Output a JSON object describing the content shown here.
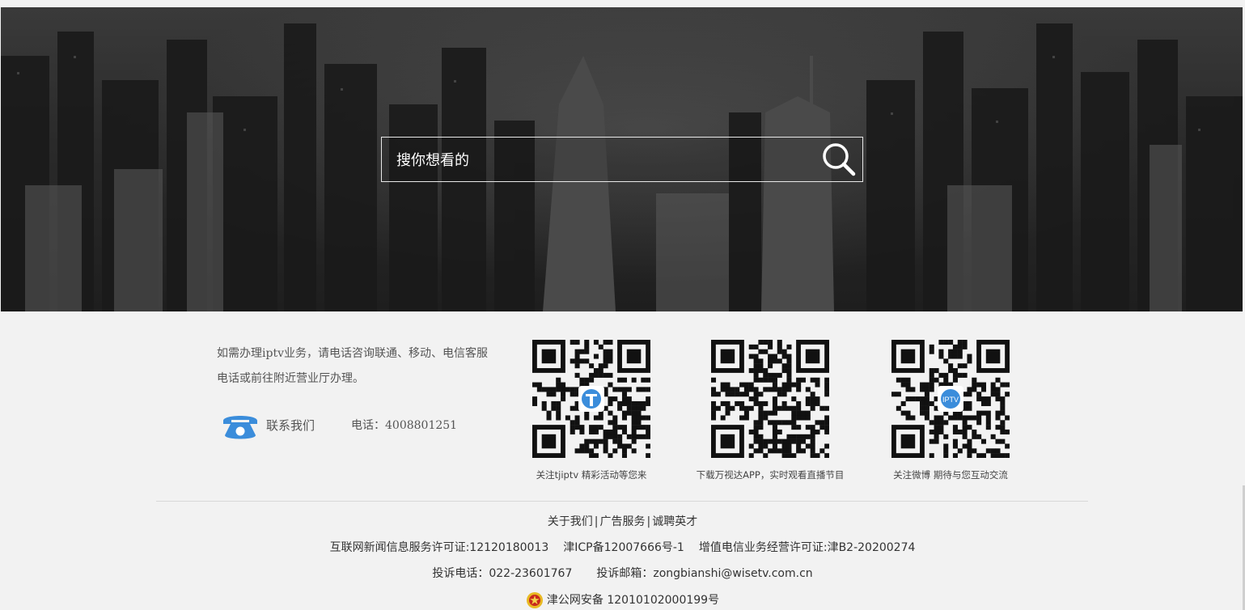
{
  "search": {
    "placeholder": "搜你想看的"
  },
  "info": {
    "text": "如需办理iptv业务，请电话咨询联通、移动、电信客服电话或前往附近营业厅办理。",
    "contact_label": "联系我们",
    "phone": "电话：4008801251"
  },
  "qrcodes": [
    {
      "caption": "关注tjiptv 精彩活动等您来",
      "center_logo": "tv-logo-icon"
    },
    {
      "caption": "下载万视达APP，实时观看直播节目",
      "center_logo": ""
    },
    {
      "caption": "关注微博  期待与您互动交流",
      "center_logo": "iptv-logo-icon",
      "logo_text": "IPTV"
    }
  ],
  "footer": {
    "links": [
      "关于我们",
      "广告服务",
      "诚聘英才"
    ],
    "separator": "|",
    "license_news": "互联网新闻信息服务许可证:12120180013",
    "icp": "津ICP备12007666号-1",
    "license_telecom": "增值电信业务经营许可证:津B2-20200274",
    "complaint_phone": "投诉电话：022-23601767",
    "complaint_email": "投诉邮箱：zongbianshi@wisetv.com.cn",
    "police_record": "津公网安备 12010102000199号"
  },
  "colors": {
    "accent_blue": "#3b8ddb",
    "hero_dark": "#2a2a2a",
    "footer_bg": "#f2f2f2"
  }
}
